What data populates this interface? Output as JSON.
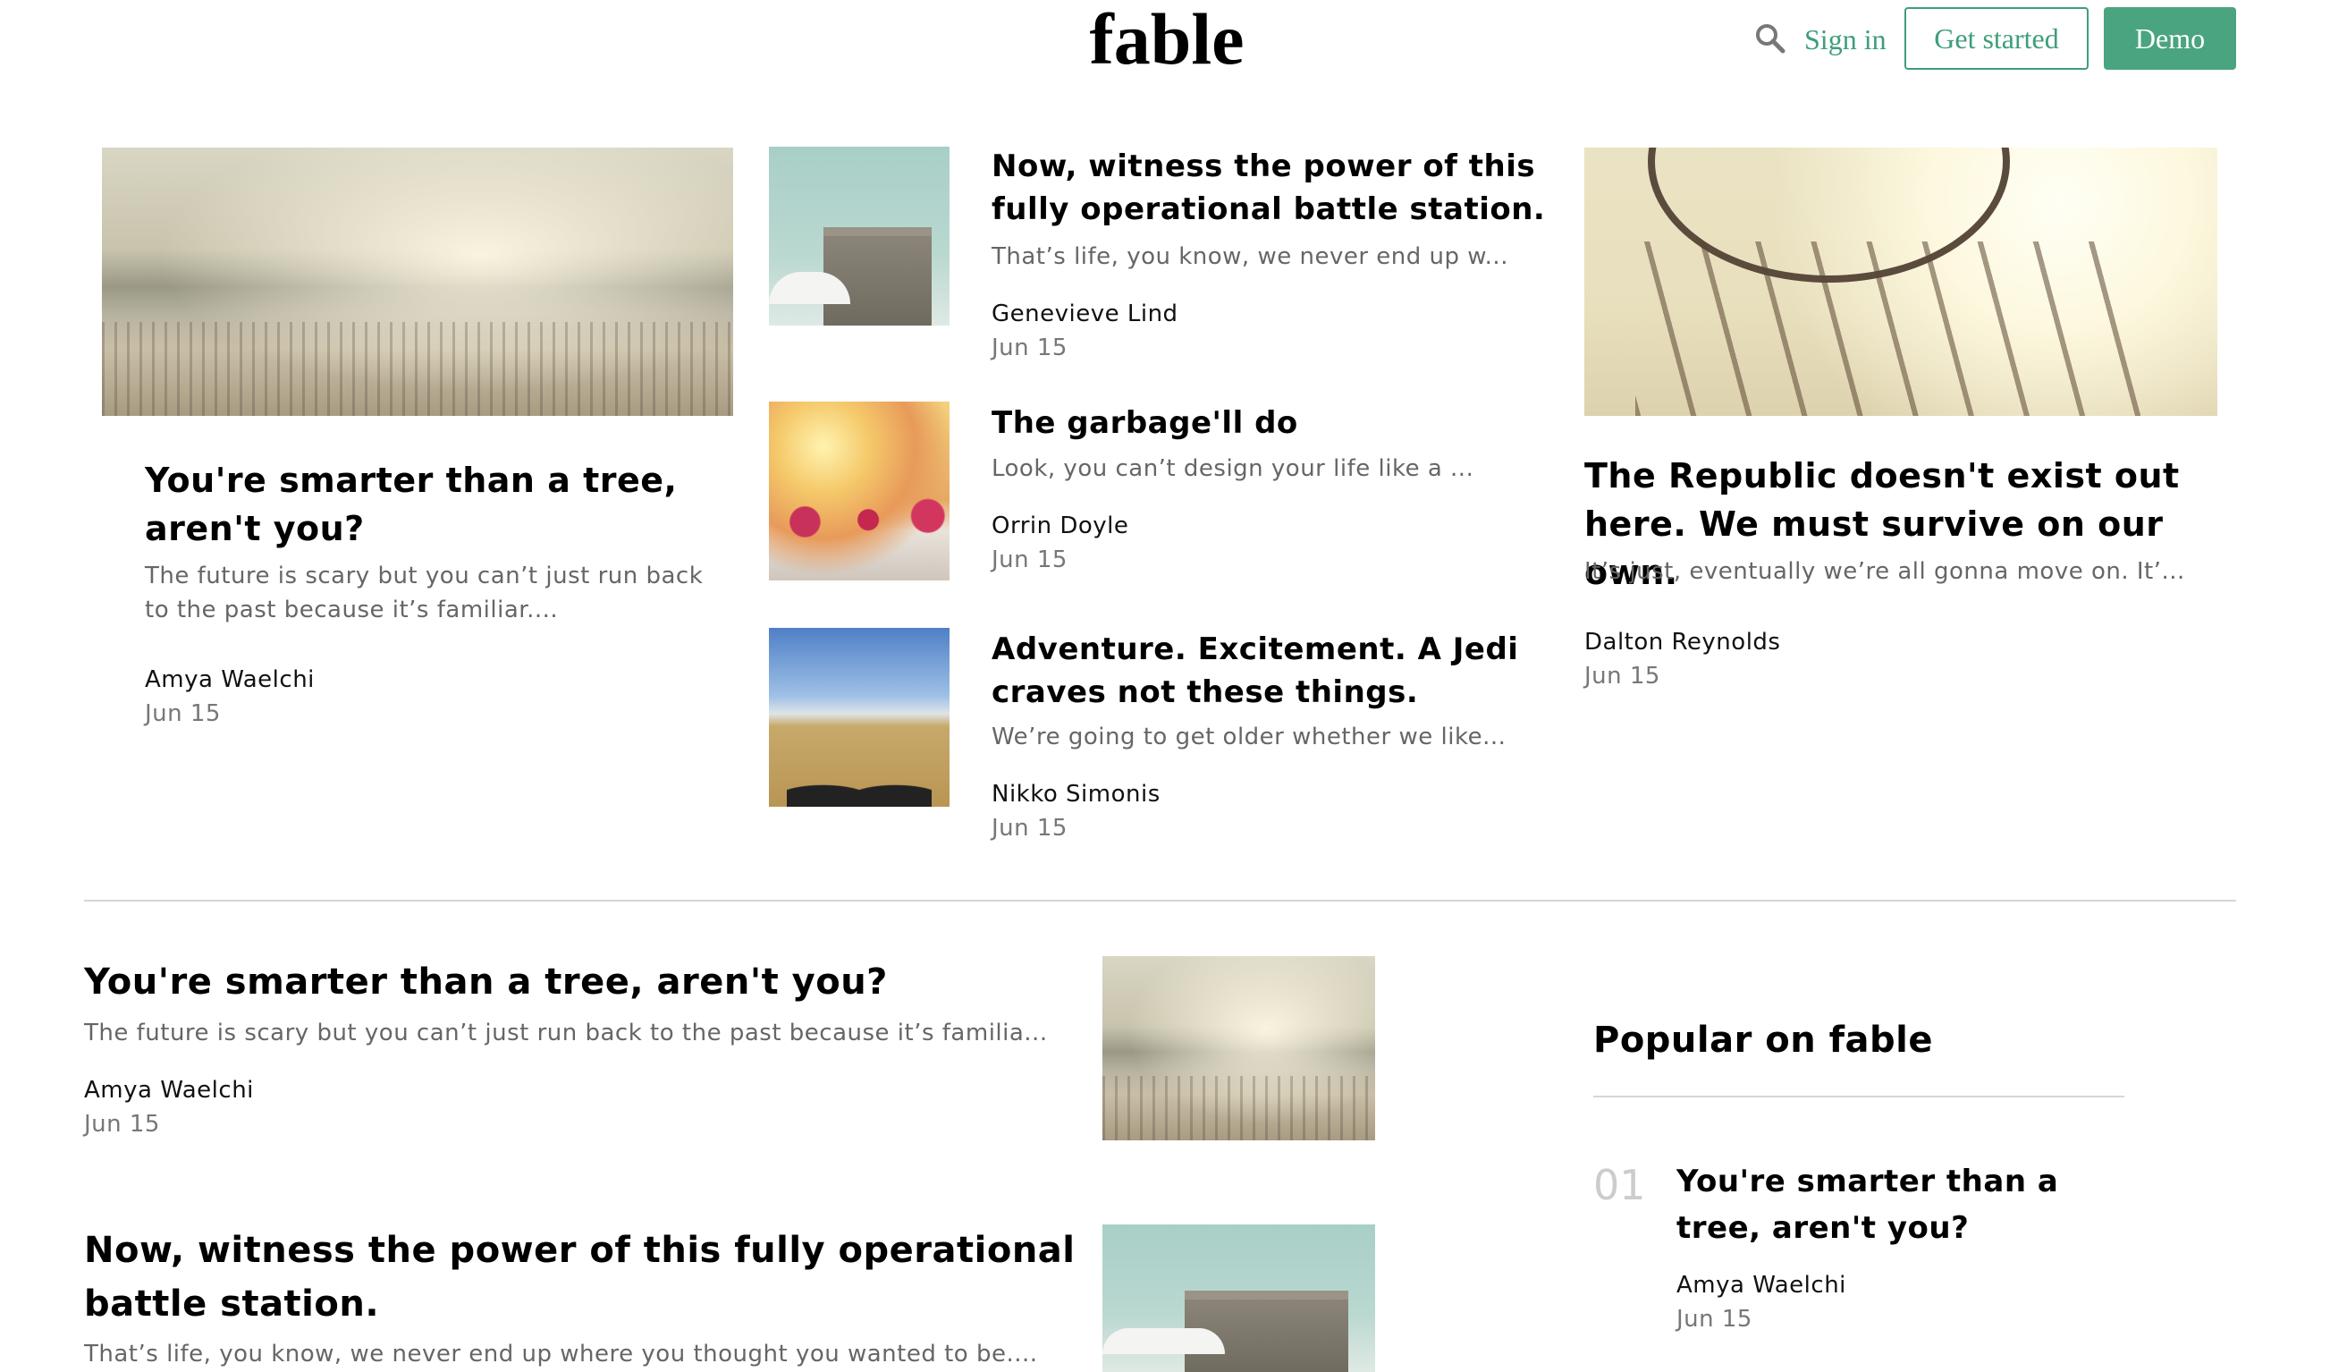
{
  "header": {
    "logo": "fable",
    "sign_in": "Sign in",
    "get_started": "Get started",
    "demo": "Demo",
    "accent_color": "#3e9e7a"
  },
  "featured": {
    "left": {
      "title": "You're smarter than a tree, aren't you?",
      "excerpt": "The future is scary but you can’t just run back to the past because it’s familiar....",
      "author": "Amya Waelchi",
      "date": "Jun 15"
    },
    "middle": [
      {
        "title": "Now, witness the power of this fully operational battle station.",
        "excerpt": "That’s life, you know, we never end up w...",
        "author": "Genevieve Lind",
        "date": "Jun 15"
      },
      {
        "title": "The garbage'll do",
        "excerpt": "Look, you can’t design your life like a ...",
        "author": "Orrin Doyle",
        "date": "Jun 15"
      },
      {
        "title": "Adventure. Excitement. A Jedi craves not these things.",
        "excerpt": "We’re going to get older whether we like...",
        "author": "Nikko Simonis",
        "date": "Jun 15"
      }
    ],
    "right": {
      "title": "The Republic doesn't exist out here. We must survive on our own.",
      "excerpt": "It’s just, eventually we’re all gonna move on. It’...",
      "author": "Dalton Reynolds",
      "date": "Jun 15"
    }
  },
  "feed": [
    {
      "title": "You're smarter than a tree, aren't you?",
      "excerpt": "The future is scary but you can’t just run back to the past because it’s familia...",
      "author": "Amya Waelchi",
      "date": "Jun 15"
    },
    {
      "title": "Now, witness the power of this fully operational battle station.",
      "excerpt": "That’s life, you know, we never end up where you thought you wanted to be...."
    }
  ],
  "popular": {
    "heading": "Popular on fable",
    "items": [
      {
        "rank": "01",
        "title": "You're smarter than a tree, aren't you?",
        "author": "Amya Waelchi",
        "date": "Jun 15"
      }
    ]
  }
}
